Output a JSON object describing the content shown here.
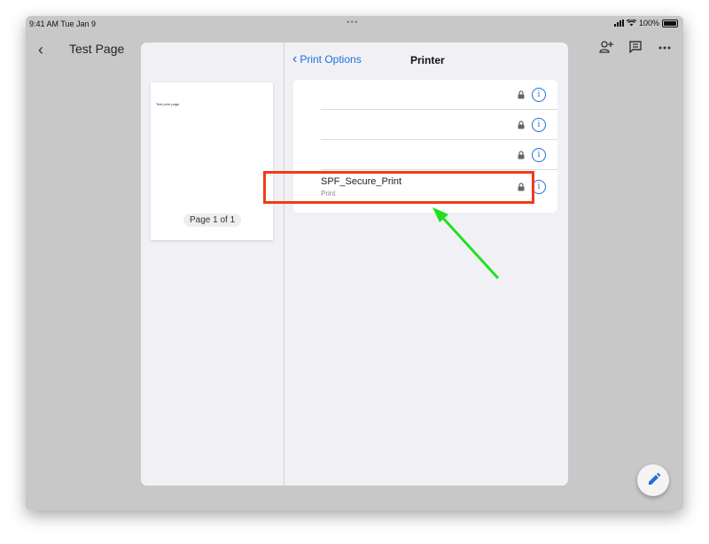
{
  "status": {
    "time": "9:41 AM  Tue Jan 9",
    "dots": "•••",
    "battery": "100%"
  },
  "header": {
    "title": "Test Page",
    "back_icon": "chevron-left-icon",
    "actions": [
      "add-person-icon",
      "comment-icon",
      "more-icon"
    ]
  },
  "preview": {
    "page_text": "Test print page",
    "page_indicator": "Page 1 of 1"
  },
  "printer_panel": {
    "back_label": "Print Options",
    "title": "Printer",
    "printers": [
      {
        "name": "",
        "subtitle": ""
      },
      {
        "name": "",
        "subtitle": ""
      },
      {
        "name": "",
        "subtitle": ""
      },
      {
        "name": "SPF_Secure_Print",
        "subtitle": "Print"
      }
    ]
  },
  "overlay": {
    "highlight_color": "#f23b18",
    "arrow_color": "#22e01f"
  },
  "colors": {
    "accent": "#1f6fd6",
    "backdrop": "#c8c8c8",
    "sheet": "#f1f1f5"
  },
  "fab": {
    "icon": "edit-pencil-icon"
  }
}
